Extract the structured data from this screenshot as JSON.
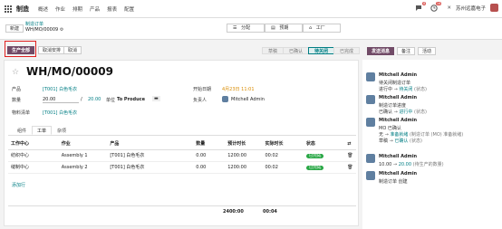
{
  "topbar": {
    "app_name": "制造",
    "menu": [
      "概述",
      "作业",
      "排期",
      "产品",
      "报表",
      "配置"
    ],
    "msg_count": "8",
    "activity_count": "16",
    "company": "苏州远嘉电子"
  },
  "control_panel": {
    "new_label": "新建",
    "parent_crumb": "制造订单",
    "current_record": "WH/MO/00009",
    "pager_left": "分配",
    "pager_mid": "预期",
    "pager_right": "工厂"
  },
  "actions": {
    "produce_all": "生产全部",
    "cancel_schedule": "取消安排",
    "cancel": "取消"
  },
  "stages": [
    "草稿",
    "已确认",
    "待关闭",
    "已完成"
  ],
  "active_stage": "待关闭",
  "chatter_actions": {
    "send_message": "发送消息",
    "log_note": "备注",
    "activity": "活动"
  },
  "form": {
    "title": "WH/MO/00009",
    "product_label": "产品",
    "product_value": "[T001] 白色毛衣",
    "quantity_label": "数量",
    "quantity_done": "20.00",
    "quantity_sep": "/",
    "quantity_total": "20.00",
    "uom_label": "单位",
    "uom_value": "To Produce",
    "bom_label": "物料清单",
    "bom_value": "[T001] 白色毛衣",
    "start_label": "开始日期",
    "start_value": "4月23日 11:01",
    "responsible_label": "负责人",
    "responsible_value": "Mitchell Admin"
  },
  "tabs": [
    "组件",
    "工单",
    "杂项"
  ],
  "active_tab": "工单",
  "workorders": {
    "headers": [
      "工作中心",
      "作业",
      "产品",
      "数量",
      "预计时长",
      "实际时长",
      "状态"
    ],
    "rows": [
      {
        "workcenter": "纺织中心",
        "operation": "Assembly 1",
        "product": "[T001] 白色毛衣",
        "qty": "0.00",
        "expected": "1200:00",
        "real": "00:02",
        "status": "已完成"
      },
      {
        "workcenter": "缝制中心",
        "operation": "Assembly 2",
        "product": "[T001] 白色毛衣",
        "qty": "0.00",
        "expected": "1200:00",
        "real": "00:02",
        "status": "已完成"
      }
    ],
    "add_line": "添加行",
    "total_expected": "2400:00",
    "total_real": "00:04"
  },
  "chatter": [
    {
      "author": "Mitchell Admin",
      "lines": [
        {
          "text": "待关闭制造订单"
        },
        {
          "old": "进行中",
          "new": "待关闭",
          "field": "(状态)"
        }
      ]
    },
    {
      "author": "Mitchell Admin",
      "lines": [
        {
          "text": "制造订单进度"
        },
        {
          "old": "已确认",
          "new": "进行中",
          "field": "(状态)"
        }
      ]
    },
    {
      "author": "Mitchell Admin",
      "lines": [
        {
          "text": "MO 已确认"
        },
        {
          "old": "无",
          "new": "准备就绪",
          "field": "(制造订单 (MO) 准备就绪)"
        },
        {
          "old": "草稿",
          "new": "已确认",
          "field": "(状态)"
        }
      ]
    },
    {
      "author": "Mitchell Admin",
      "lines": [
        {
          "old": "10.00",
          "new": "20.00",
          "field": "(待生产的数量)"
        }
      ]
    },
    {
      "author": "Mitchell Admin",
      "lines": [
        {
          "text": "制造订单 创建"
        }
      ]
    }
  ]
}
